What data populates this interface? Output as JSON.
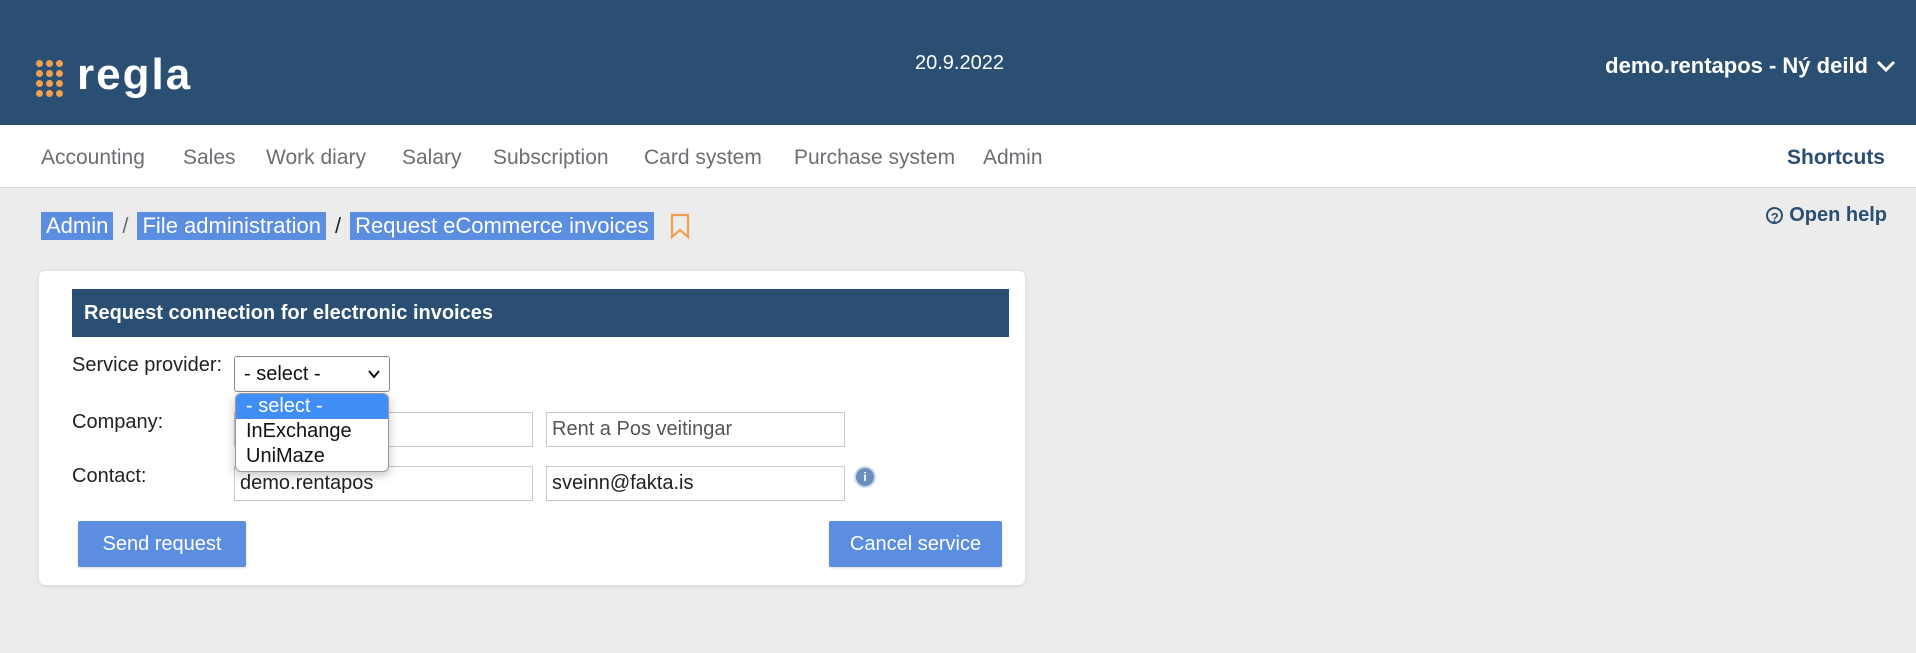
{
  "header": {
    "logo_text": "regla",
    "date": "20.9.2022",
    "user_menu": "demo.rentapos - Ný deild",
    "colors": {
      "header_bg": "#2a4f73",
      "logo_dots": "#f0a050"
    }
  },
  "nav": {
    "items": [
      "Accounting",
      "Sales",
      "Work diary",
      "Salary",
      "Subscription",
      "Card system",
      "Purchase system",
      "Admin"
    ],
    "shortcuts": "Shortcuts"
  },
  "breadcrumb": {
    "items": [
      "Admin",
      "File administration",
      "Request eCommerce invoices"
    ],
    "separator": "/",
    "bookmark_icon": "bookmark-icon"
  },
  "help": {
    "label": "Open help",
    "icon": "question-circle-icon"
  },
  "form": {
    "title": "Request connection for electronic invoices",
    "service_provider_label": "Service provider:",
    "service_provider_value": "- select -",
    "service_provider_options": [
      "- select -",
      "InExchange",
      "UniMaze"
    ],
    "company_label": "Company:",
    "company_name": "Rent a Pos veitingar",
    "contact_label": "Contact:",
    "contact_user": "demo.rentapos",
    "contact_email": "sveinn@fakta.is",
    "info_icon": "info-icon",
    "send_button": "Send request",
    "cancel_button": "Cancel service",
    "colors": {
      "button": "#5b8de0",
      "option_selected": "#3f8ef5"
    }
  }
}
